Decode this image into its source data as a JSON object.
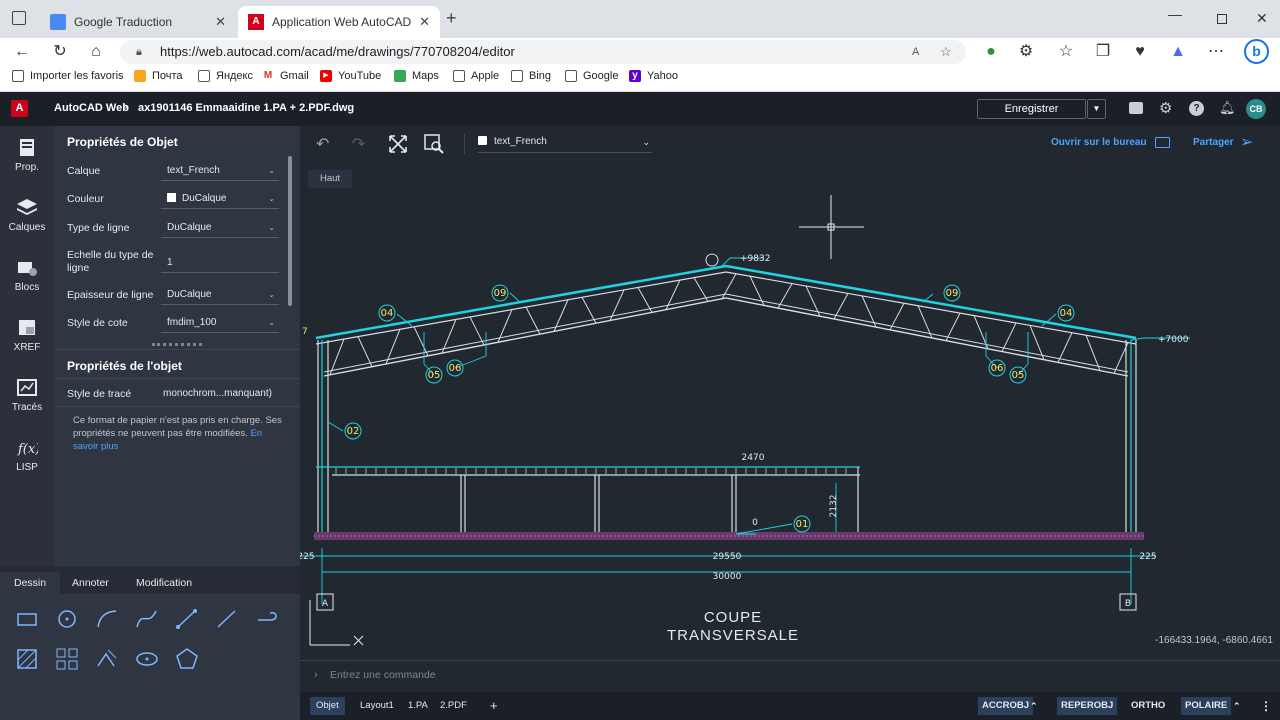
{
  "browser": {
    "tabs": [
      {
        "title": "Google Traduction",
        "active": false
      },
      {
        "title": "Application Web AutoCAD – Visu",
        "active": true
      }
    ],
    "url": "https://web.autocad.com/acad/me/drawings/770708204/editor",
    "bookmarks": [
      "Importer les favoris",
      "Почта",
      "Яндекс",
      "Gmail",
      "YouTube",
      "Maps",
      "Apple",
      "Bing",
      "Google",
      "Yahoo"
    ]
  },
  "app": {
    "name": "AutoCAD Web",
    "file": "ax1901146 Emmaaidine 1.PA + 2.PDF.dwg",
    "save_label": "Enregistrer",
    "avatar": "CB",
    "open_desktop": "Ouvrir sur le bureau",
    "share": "Partager",
    "layer_select": "text_French",
    "view_label": "Haut"
  },
  "leftnav": [
    {
      "label": "Prop.",
      "icon": "properties-icon"
    },
    {
      "label": "Calques",
      "icon": "layers-icon"
    },
    {
      "label": "Blocs",
      "icon": "blocks-icon"
    },
    {
      "label": "XREF",
      "icon": "xref-icon"
    },
    {
      "label": "Tracés",
      "icon": "plot-icon"
    },
    {
      "label": "LISP",
      "icon": "lisp-icon"
    }
  ],
  "panel": {
    "title1": "Propriétés de Objet",
    "rows": [
      {
        "label": "Calque",
        "value": "text_French"
      },
      {
        "label": "Couleur",
        "value": "DuCalque"
      },
      {
        "label": "Type de ligne",
        "value": "DuCalque"
      },
      {
        "label": "Echelle du type de ligne",
        "value": "1"
      },
      {
        "label": "Epaisseur de ligne",
        "value": "DuCalque"
      },
      {
        "label": "Style de cote",
        "value": "fmdim_100"
      }
    ],
    "title2": "Propriétés de l'objet",
    "plot_label": "Style de tracé",
    "plot_value": "monochrom...manquant)",
    "note": "Ce format de papier n'est pas pris en charge. Ses propriétés ne peuvent pas être modifiées.",
    "learn_more": "En savoir plus"
  },
  "tooltabs": [
    "Dessin",
    "Annoter",
    "Modification"
  ],
  "drawing": {
    "labels": [
      "+9832",
      "+7000",
      "09",
      "09",
      "04",
      "04",
      "05",
      "06",
      "06",
      "05",
      "02",
      "01",
      "2470",
      "2132",
      "0",
      "225",
      "225",
      "29550",
      "30000",
      "A",
      "B"
    ],
    "title_line1": "COUPE",
    "title_line2": "TRANSVERSALE",
    "coords": "-166433.1964, -6860.4661",
    "left_stub": "7"
  },
  "command_placeholder": "Entrez une commande",
  "layout_tabs": [
    "Objet",
    "Layout1",
    "1.PA",
    "2.PDF"
  ],
  "status_buttons": [
    "ACCROBJ",
    "REPEROBJ",
    "ORTHO",
    "POLAIRE"
  ],
  "colors": {
    "accent": "#4da3ff",
    "cyan": "#1fd3e0",
    "panel": "#2f3541",
    "canvas": "#212830"
  }
}
